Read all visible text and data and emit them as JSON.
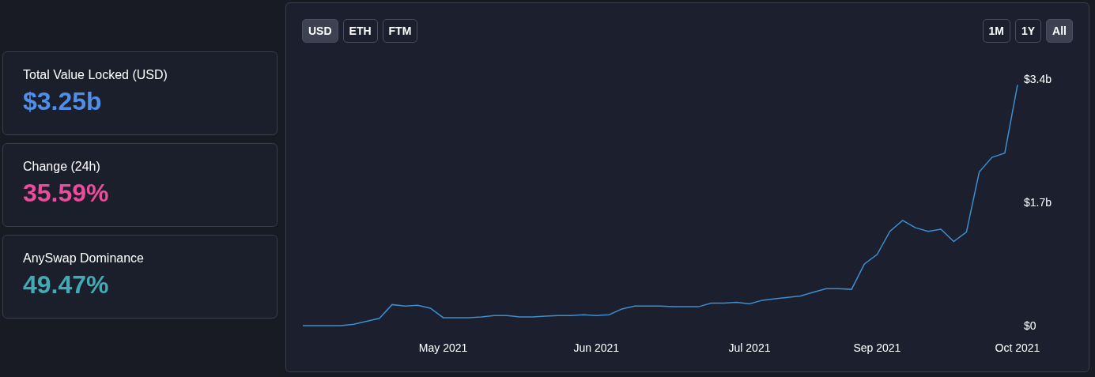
{
  "stats": [
    {
      "label": "Total Value Locked (USD)",
      "value": "$3.25b",
      "color": "#4f8fea"
    },
    {
      "label": "Change (24h)",
      "value": "35.59%",
      "color": "#ed4b9e"
    },
    {
      "label": "AnySwap Dominance",
      "value": "49.47%",
      "color": "#45a9b3"
    }
  ],
  "currency_buttons": [
    {
      "label": "USD",
      "selected": true
    },
    {
      "label": "ETH",
      "selected": false
    },
    {
      "label": "FTM",
      "selected": false
    }
  ],
  "range_buttons": [
    {
      "label": "1M",
      "selected": false
    },
    {
      "label": "1Y",
      "selected": false
    },
    {
      "label": "All",
      "selected": true
    }
  ],
  "chart": {
    "chart_data": {
      "type": "line",
      "ylim": [
        0,
        3.4
      ],
      "yticks": [
        {
          "value": 0,
          "label": "$0"
        },
        {
          "value": 1.7,
          "label": "$1.7b"
        },
        {
          "value": 3.4,
          "label": "$3.4b"
        }
      ],
      "categories": [
        null,
        null,
        null,
        null,
        null,
        null,
        null,
        null,
        null,
        null,
        null,
        "May 2021",
        null,
        null,
        null,
        null,
        null,
        null,
        null,
        null,
        null,
        null,
        null,
        "Jun 2021",
        null,
        null,
        null,
        null,
        null,
        null,
        null,
        null,
        null,
        null,
        null,
        "Jul 2021",
        null,
        null,
        null,
        null,
        null,
        null,
        null,
        null,
        null,
        "Sep 2021",
        null,
        null,
        null,
        null,
        null,
        null,
        null,
        null,
        null,
        null,
        "Oct 2021"
      ],
      "series": [
        {
          "color": "#3d8fd1",
          "values": [
            0,
            0,
            0,
            0,
            0.02,
            0.06,
            0.1,
            0.29,
            0.27,
            0.28,
            0.24,
            0.11,
            0.11,
            0.11,
            0.12,
            0.14,
            0.14,
            0.12,
            0.12,
            0.13,
            0.14,
            0.14,
            0.15,
            0.14,
            0.15,
            0.23,
            0.27,
            0.27,
            0.27,
            0.26,
            0.26,
            0.26,
            0.31,
            0.31,
            0.32,
            0.3,
            0.35,
            0.37,
            0.39,
            0.41,
            0.46,
            0.51,
            0.51,
            0.5,
            0.85,
            0.98,
            1.3,
            1.45,
            1.35,
            1.3,
            1.33,
            1.16,
            1.29,
            2.12,
            2.32,
            2.38,
            3.32
          ]
        }
      ]
    }
  }
}
